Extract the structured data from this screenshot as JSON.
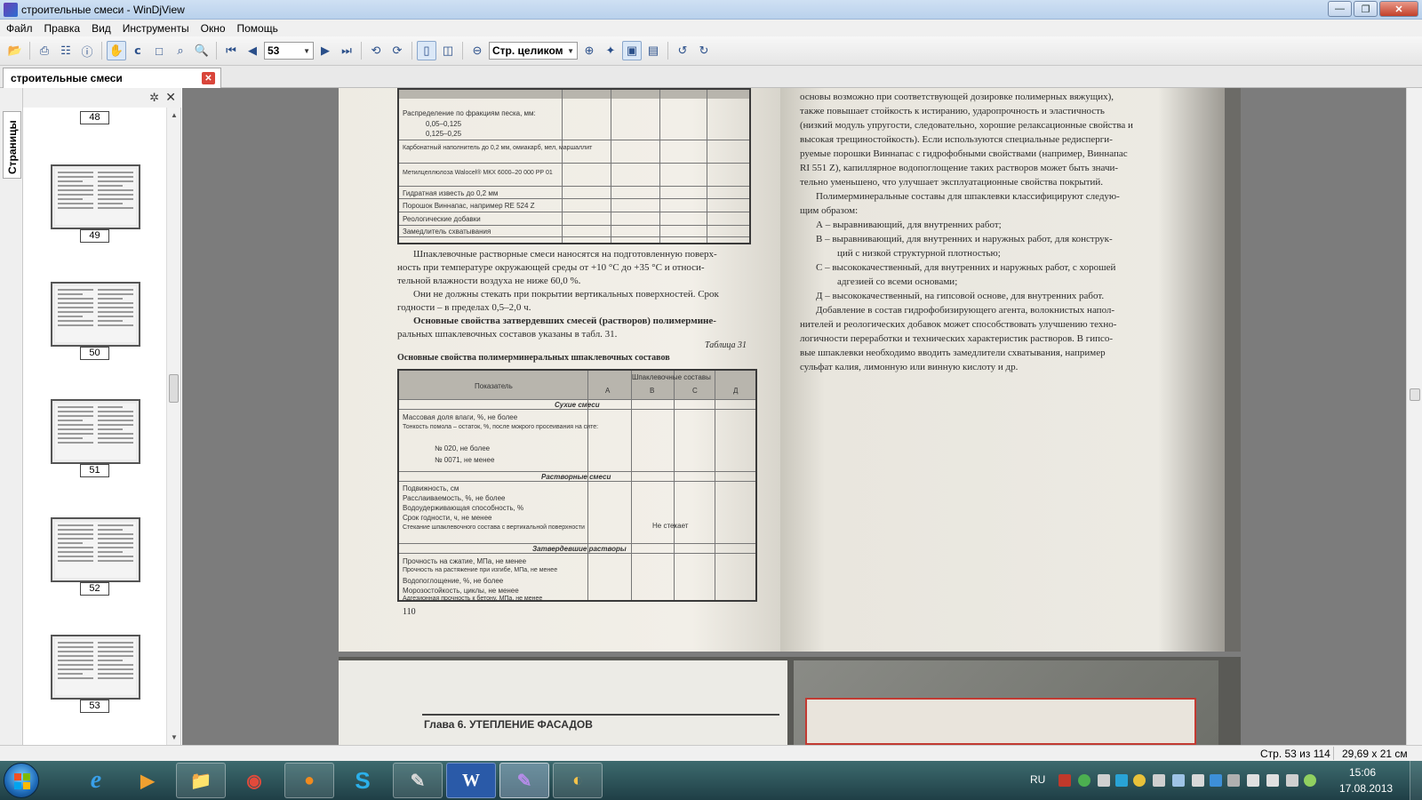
{
  "window": {
    "title": "строительные смеси - WinDjView",
    "min_label": "—",
    "max_label": "❐",
    "close_label": "✕"
  },
  "menu": [
    "Файл",
    "Правка",
    "Вид",
    "Инструменты",
    "Окно",
    "Помощь"
  ],
  "toolbar": {
    "page_value": "53",
    "zoom_value": "Стр. целиком"
  },
  "tab": {
    "title": "строительные смеси",
    "close_label": "✕"
  },
  "side_panel": {
    "vertical_tab": "Страницы",
    "gear_label": "✲",
    "close_label": "✕"
  },
  "thumbnails": [
    "48",
    "49",
    "50",
    "51",
    "52",
    "53"
  ],
  "document": {
    "left_page": {
      "paragraph_1": "Шпаклевочные растворные смеси наносятся на подготовленную поверх-",
      "paragraph_1b": "ность при температуре окружающей среды от +10 °С до +35 °С и относи-",
      "paragraph_1c": "тельной влажности воздуха не ниже 60,0 %.",
      "paragraph_2": "Они не должны стекать при покрытии вертикальных поверхностей. Срок",
      "paragraph_2b": "годности – в пределах 0,5–2,0 ч.",
      "paragraph_3": "Основные свойства затвердевших смесей (растворов) полимермине-",
      "paragraph_3b": "ральных шпаклевочных составов указаны в табл. 31.",
      "table_caption": "Таблица 31",
      "table_title": "Основные свойства полимерминеральных шпаклевочных составов",
      "page_number": "110",
      "top_table_rows": [
        "Распределение по фракциям песка, мм:",
        "0,05–0,125",
        "0,125–0,25",
        "Карбонатный наполнитель до 0,2 мм, омиакарб, мел, маршаллит",
        "Метилцеллюлоза Walocel® МКХ 6000–20 000 РР 01",
        "Гидратная известь до 0,2 мм",
        "Порошок Виннапас, например RE 524 Z",
        "Реологические добавки",
        "Замедлитель схватывания"
      ],
      "bottom_table_header": "Показатель",
      "bottom_table_cols": [
        "А",
        "В",
        "С",
        "Д"
      ],
      "bottom_table_group": "Шпаклевочные составы",
      "bottom_table_sections": [
        "Сухие смеси",
        "Растворные смеси",
        "Затвердевшие растворы"
      ],
      "bottom_table_rows": [
        "Массовая доля влаги, %, не более",
        "Тонкость помола – остаток, %, после мокрого просеивания на сите:",
        "№ 020, не более",
        "№ 0071, не менее",
        "Подвижность, см",
        "Расслаиваемость, %, не более",
        "Водоудерживающая способность, %",
        "Срок годности, ч, не менее",
        "Стекание шпаклевочного состава с вертикальной поверхности",
        "Прочность на сжатие, МПа, не менее",
        "Прочность на растяжение при изгибе, МПа, не менее",
        "Водопоглощение, %, не более",
        "Морозостойкость, циклы, не менее",
        "Адгезионная прочность к бетону, МПа, не менее"
      ],
      "not_flowing": "Не стекает"
    },
    "right_page": {
      "lines": [
        "основы возможно при соответствующей дозировке полимерных вяжущих),",
        "также повышает стойкость к истиранию, ударопрочность и эластичность",
        "(низкий модуль упругости, следовательно, хорошие релаксационные свойства и",
        "высокая трещиностойкость). Если используются специальные редисперги-",
        "руемые порошки Виннапас с гидрофобными свойствами (например, Виннапас",
        "RI 551 Z), капиллярное водопоглощение таких растворов может быть значи-",
        "тельно уменьшено, что улучшает эксплуатационные свойства покрытий.",
        "Полимерминеральные составы для шпаклевки классифицируют следую-",
        "щим образом:",
        "А – выравнивающий, для внутренних работ;",
        "В – выравнивающий, для внутренних и наружных работ, для конструк-",
        "ций с низкой структурной плотностью;",
        "С – высококачественный, для внутренних и наружных работ, с хорошей",
        "адгезией со всеми основами;",
        "Д – высококачественный, на гипсовой основе, для внутренних работ.",
        "Добавление в состав гидрофобизирующего агента, волокнистых напол-",
        "нителей и реологических добавок может способствовать улучшению техно-",
        "логичности переработки и технических характеристик растворов. В гипсо-",
        "вые шпаклевки необходимо вводить замедлители схватывания, например",
        "сульфат калия, лимонную или винную кислоту и др."
      ]
    },
    "next_page_heading": "Глава 6.  УТЕПЛЕНИЕ  ФАСАДОВ"
  },
  "status": {
    "page_info": "Стр. 53 из 114",
    "page_size": "29,69 x 21 см"
  },
  "taskbar": {
    "language": "RU",
    "time": "15:06",
    "date": "17.08.2013"
  }
}
